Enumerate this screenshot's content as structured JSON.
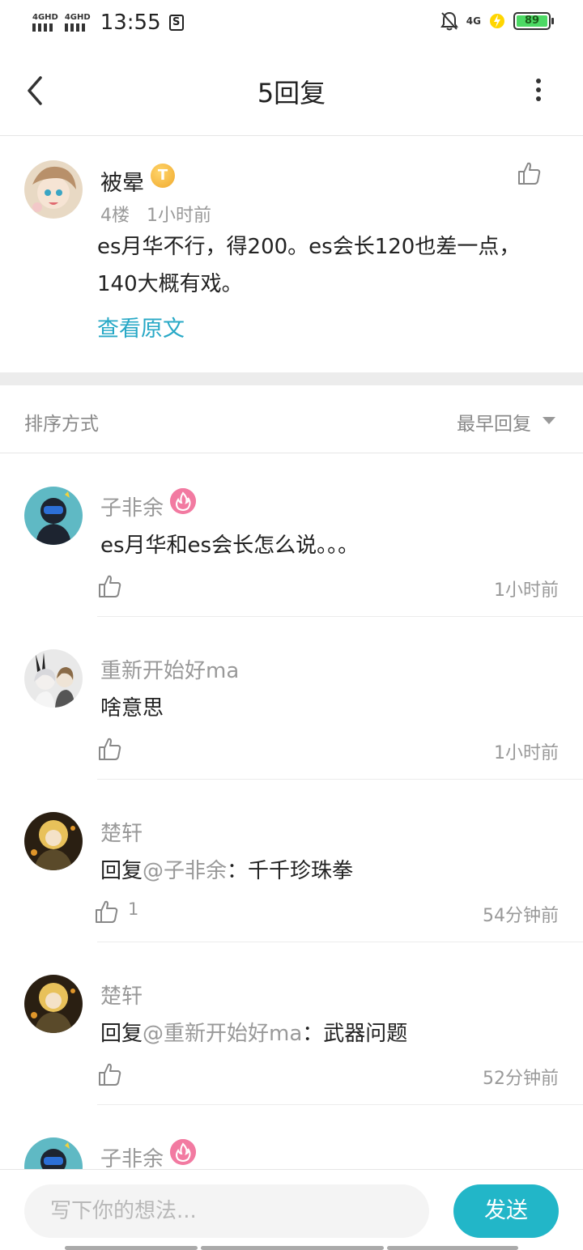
{
  "status_bar": {
    "signal1": "4GHD",
    "signal2": "4GHD",
    "time": "13:55",
    "network": "4G",
    "battery": "89",
    "icons": [
      "signal-icon",
      "signal-icon",
      "s-badge-icon",
      "bell-off-icon",
      "charging-icon",
      "battery-icon"
    ]
  },
  "header": {
    "title": "5回复"
  },
  "post": {
    "author": "被晕",
    "badge": "T",
    "floor": "4楼",
    "time": "1小时前",
    "text": "es月华不行，得200。es会长120也差一点，140大概有戏。",
    "view_original": "查看原文"
  },
  "sort": {
    "label": "排序方式",
    "value": "最早回复"
  },
  "replies": [
    {
      "name": "子非余",
      "has_badge": true,
      "text": "es月华和es会长怎么说。。。",
      "mention": "",
      "likes": "",
      "time": "1小时前"
    },
    {
      "name": "重新开始好ma",
      "has_badge": false,
      "text": "啥意思",
      "mention": "",
      "likes": "",
      "time": "1小时前"
    },
    {
      "name": "楚轩",
      "has_badge": false,
      "prefix": "回复",
      "mention": "@子非余",
      "text": "：千千珍珠拳",
      "likes": "1",
      "time": "54分钟前"
    },
    {
      "name": "楚轩",
      "has_badge": false,
      "prefix": "回复",
      "mention": "@重新开始好ma",
      "text": "：武器问题",
      "likes": "",
      "time": "52分钟前"
    },
    {
      "name": "子非余",
      "has_badge": true
    }
  ],
  "input": {
    "placeholder": "写下你的想法...",
    "send": "发送"
  },
  "colors": {
    "accent": "#22b6c8",
    "link": "#27a8c6",
    "badge_fire": "#f27aa1",
    "badge_gold": "#f0a92d"
  }
}
